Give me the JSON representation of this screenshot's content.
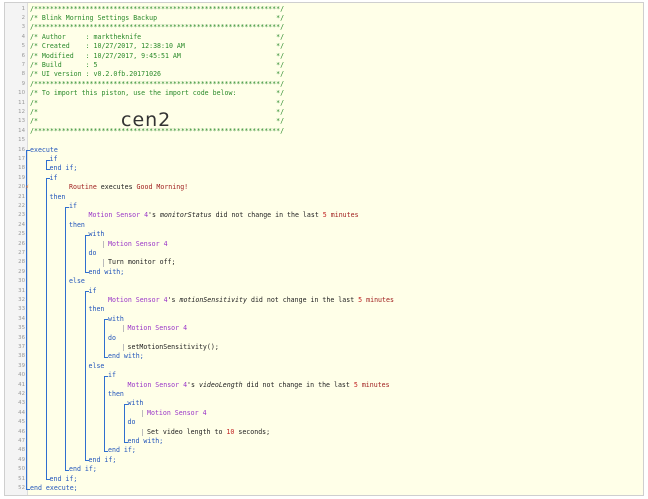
{
  "editor": {
    "header_lines": [
      "/**************************************************************/",
      "/* Blink Morning Settings Backup                              */",
      "/**************************************************************/",
      "/* Author     : marktheknife                                  */",
      "/* Created    : 10/27/2017, 12:38:10 AM                       */",
      "/* Modified   : 10/27/2017, 9:45:51 AM                        */",
      "/* Build      : 5                                             */",
      "/* UI version : v0.2.0fb.20171026                             */",
      "/**************************************************************/",
      "/* To import this piston, use the import code below:          */",
      "/*                                                            */",
      "/*                                                            */",
      "/*                                                            */",
      "/**************************************************************/"
    ],
    "import_code": "cen2",
    "code": {
      "execute": "execute",
      "if": "if",
      "end_if": "end if;",
      "routine": "Routine",
      "executes": "executes",
      "good_morning": "Good Morning!",
      "then": "then",
      "else": "else",
      "with": "with",
      "do": "do",
      "end_with": "end with;",
      "end_execute": "end execute;",
      "motion_sensor": "Motion Sensor 4",
      "possessive": "'s",
      "monitor_status": "monitorStatus",
      "motion_sensitivity": "motionSensitivity",
      "video_length": "videoLength",
      "did_not_change": "did not change in the last",
      "five": "5",
      "minutes": "minutes",
      "turn_monitor_off": "Turn monitor off;",
      "set_motion_sensitivity": "setMotionSensitivity();",
      "set_video_length": "Set video length to",
      "ten": "10",
      "seconds": "seconds;"
    }
  }
}
